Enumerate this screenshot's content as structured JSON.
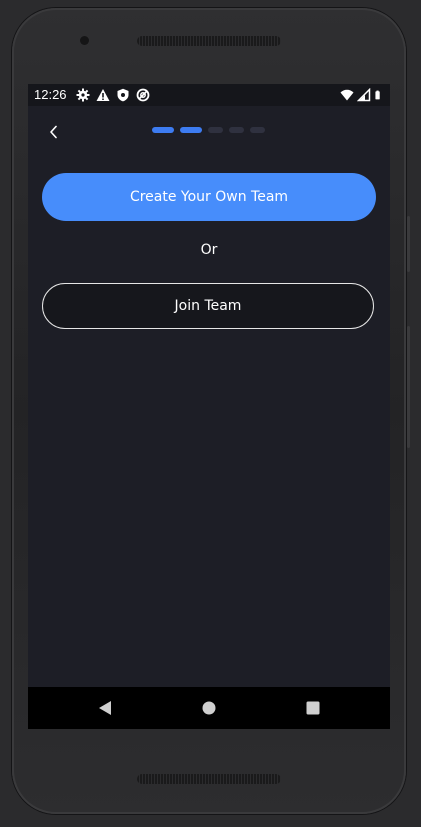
{
  "status_bar": {
    "time": "12:26",
    "left_icons": [
      "gear-icon",
      "warning-icon",
      "shield-icon",
      "sync-icon"
    ],
    "right_icons": [
      "wifi-icon",
      "cell-signal-icon",
      "battery-icon"
    ]
  },
  "header": {
    "back_icon": "chevron-left-icon",
    "progress": {
      "total_steps": 5,
      "current_step": 2
    }
  },
  "main": {
    "create_team_label": "Create Your Own Team",
    "or_label": "Or",
    "join_team_label": "Join Team"
  },
  "nav_bar": {
    "buttons": [
      "back-triangle-icon",
      "home-circle-icon",
      "recents-square-icon"
    ]
  },
  "colors": {
    "accent": "#478dfb",
    "progress_active": "#3d7cf1",
    "progress_inactive": "#2f313f",
    "screen_bg": "#1d1e26"
  }
}
